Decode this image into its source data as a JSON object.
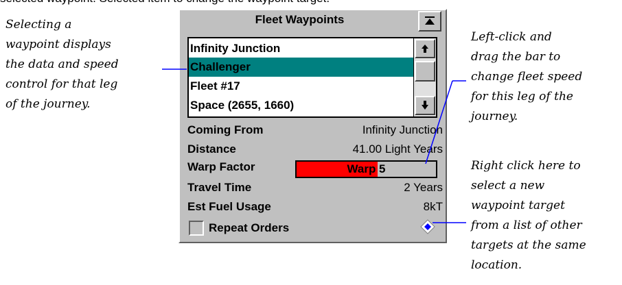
{
  "caption_top": "selected waypoint. Selected item to change the waypoint target.",
  "annotations": {
    "left": [
      "Selecting a",
      "waypoint displays",
      "the data and speed",
      "control for that leg",
      "of the journey."
    ],
    "right_top": [
      "Left-click and",
      "drag the bar to",
      "change fleet speed",
      "for this leg of the",
      "journey."
    ],
    "right_bottom": [
      "Right click here to",
      "select a new",
      "waypoint target",
      "from a list of other",
      "targets at the same",
      "location."
    ]
  },
  "panel": {
    "title": "Fleet Waypoints",
    "collapse_icon": "collapse-up-icon",
    "waypoints": [
      {
        "label": "Infinity Junction",
        "selected": false
      },
      {
        "label": "Challenger",
        "selected": true
      },
      {
        "label": "Fleet #17",
        "selected": false
      },
      {
        "label": "Space (2655, 1660)",
        "selected": false
      }
    ],
    "fields": {
      "coming_from": {
        "label": "Coming From",
        "value": "Infinity Junction"
      },
      "distance": {
        "label": "Distance",
        "value": "41.00 Light Years"
      },
      "warp_factor": {
        "label": "Warp Factor",
        "value": "Warp 5",
        "fill_fraction": 0.58
      },
      "travel_time": {
        "label": "Travel Time",
        "value": "2 Years"
      },
      "est_fuel": {
        "label": "Est Fuel Usage",
        "value": "8kT"
      }
    },
    "repeat_orders": {
      "label": "Repeat Orders",
      "checked": false
    }
  },
  "colors": {
    "panel_bg": "#c0c0c0",
    "selection": "#008080",
    "warp_fill": "#ff0000",
    "callout_line": "#0000ff",
    "diamond": "#0000ff"
  }
}
